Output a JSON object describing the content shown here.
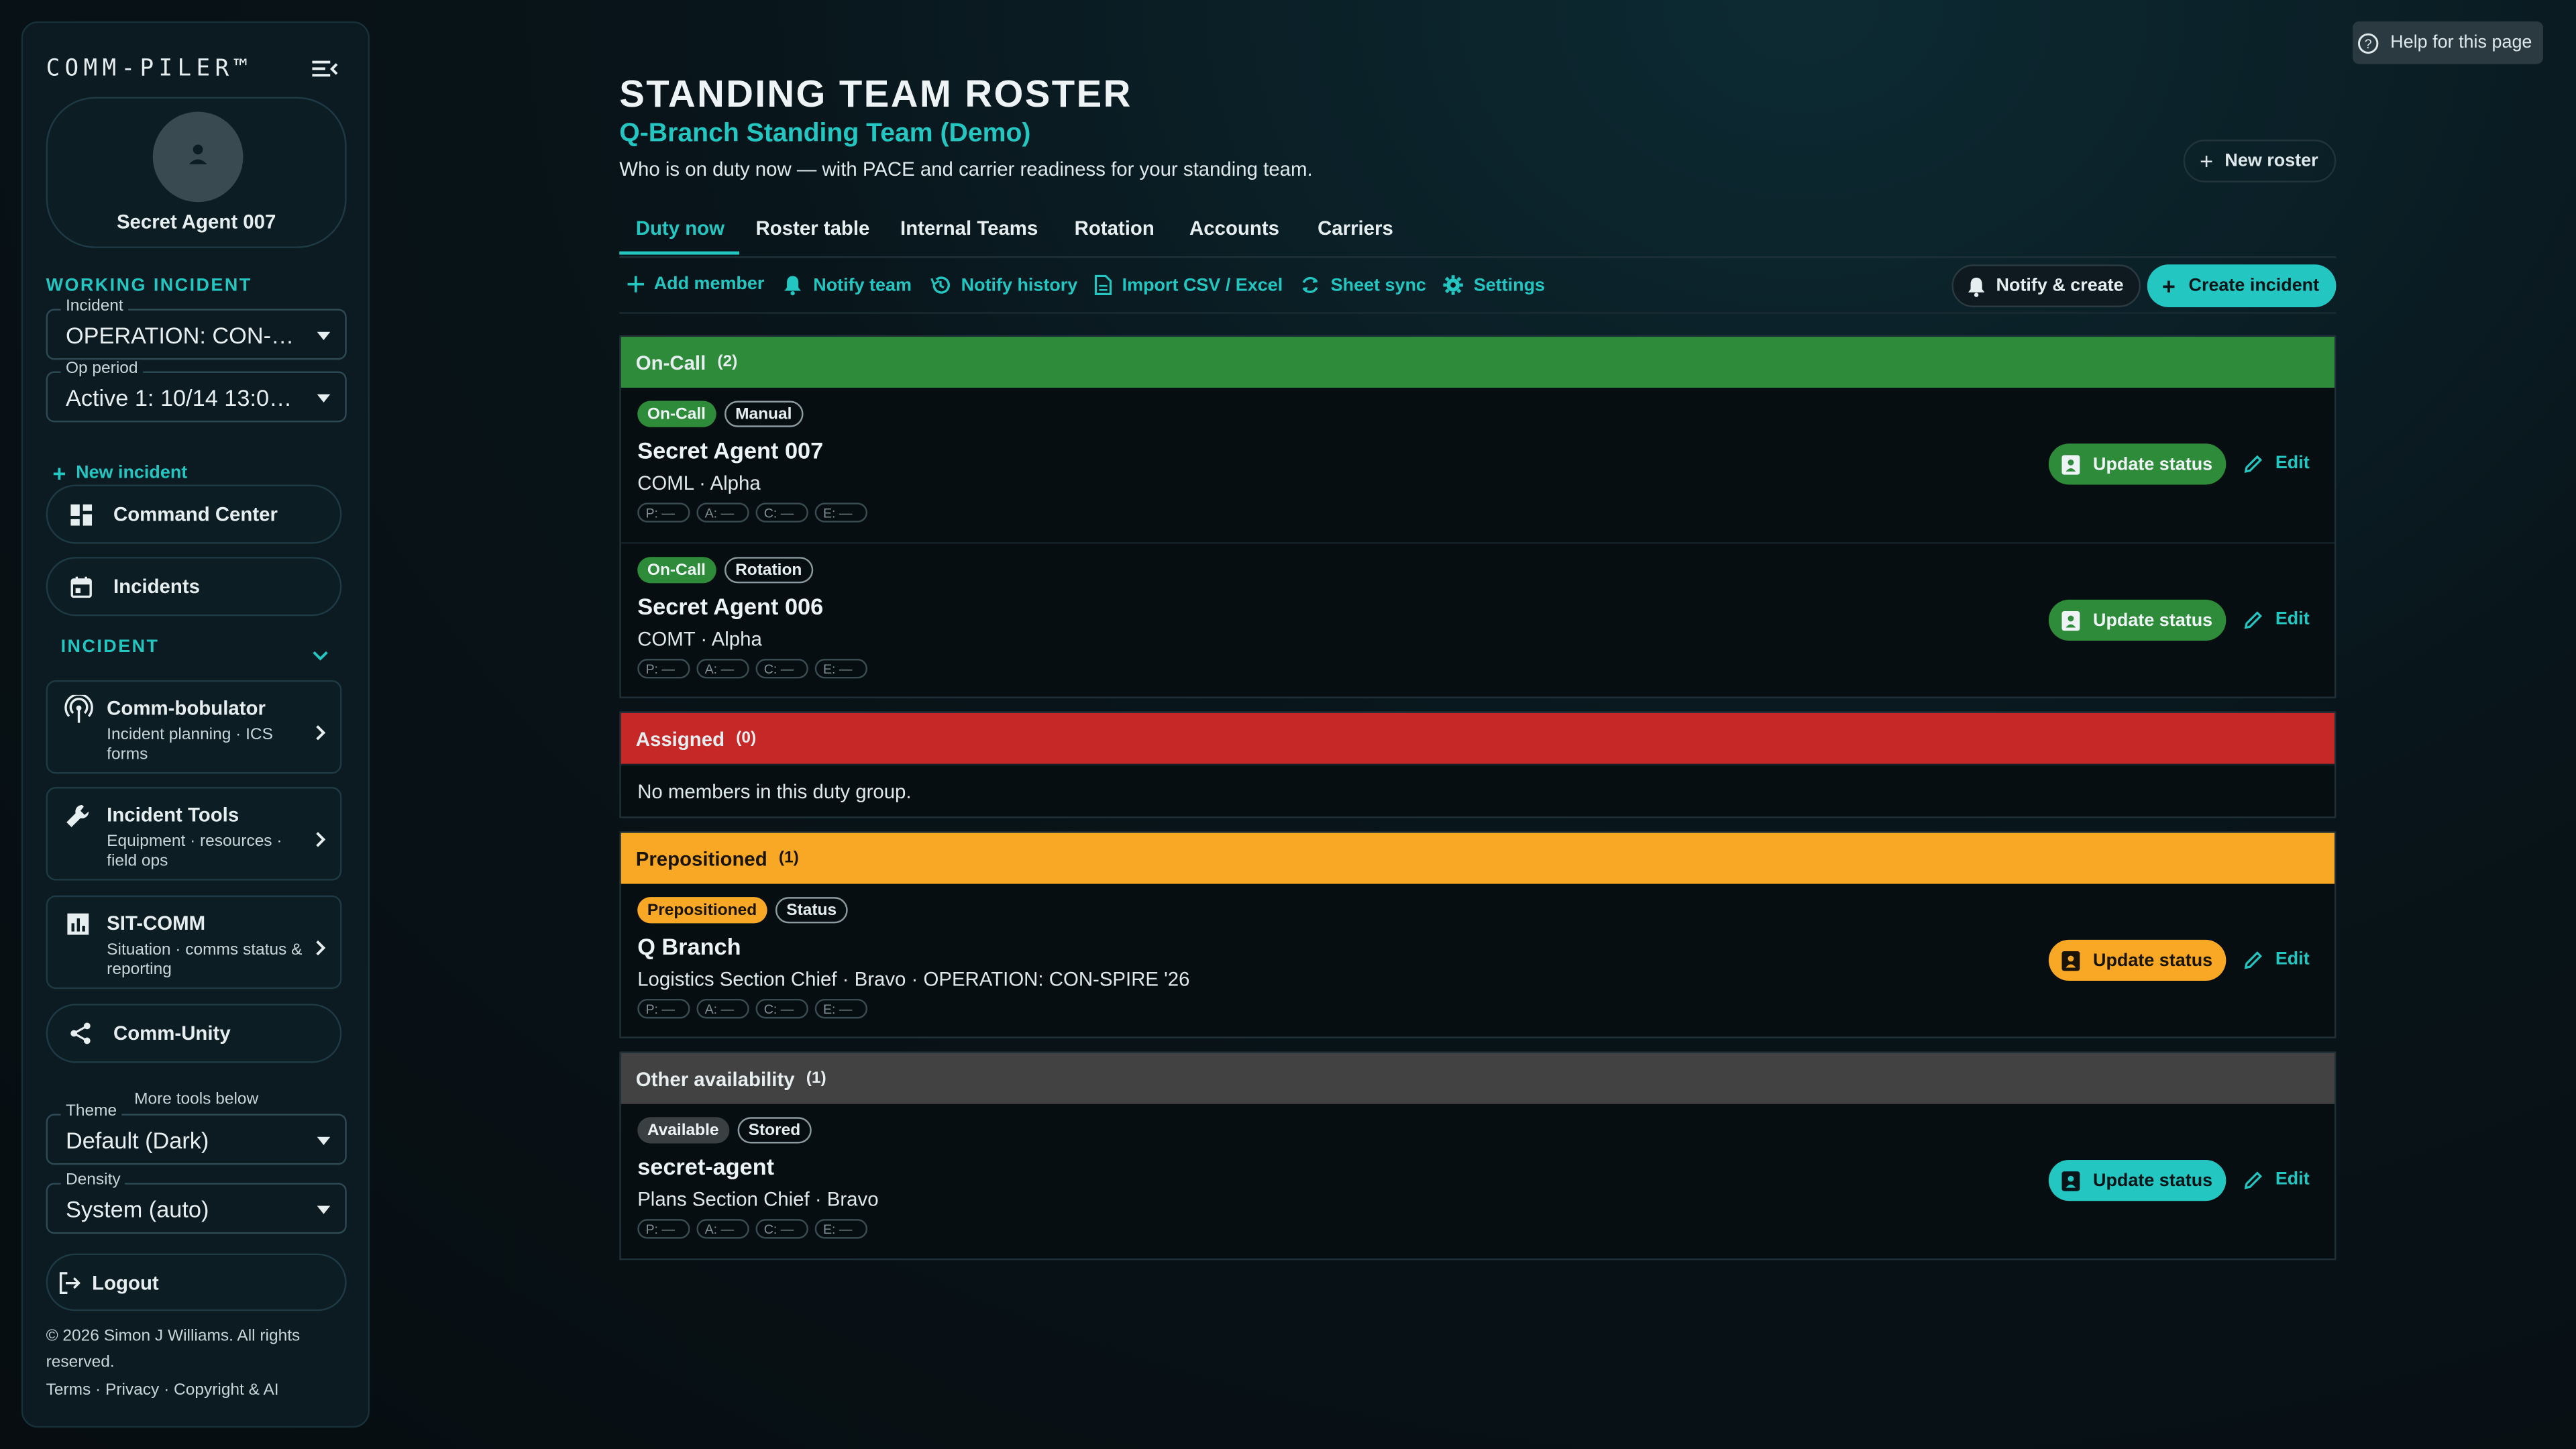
{
  "sidebar": {
    "brand": "COMM-PILER™",
    "user_name": "Secret Agent 007",
    "working_incident_label": "WORKING INCIDENT",
    "incident_field": {
      "label": "Incident",
      "value": "OPERATION: CON-SP..."
    },
    "op_period_field": {
      "label": "Op period",
      "value": "Active 1: 10/14 13:00–..."
    },
    "new_incident": "New incident",
    "command_center": "Command Center",
    "incidents": "Incidents",
    "incident_section": "INCIDENT",
    "tools": [
      {
        "title": "Comm-bobulator",
        "sub": "Incident planning · ICS forms"
      },
      {
        "title": "Incident Tools",
        "sub": "Equipment · resources · field ops"
      },
      {
        "title": "SIT-COMM",
        "sub": "Situation · comms status & reporting"
      }
    ],
    "comm_unity": "Comm-Unity",
    "more_tools": "More tools below",
    "theme_field": {
      "label": "Theme",
      "value": "Default (Dark)"
    },
    "density_field": {
      "label": "Density",
      "value": "System (auto)"
    },
    "logout": "Logout",
    "copyright": "© 2026 Simon J Williams. All rights reserved.",
    "legal": "Terms · Privacy · Copyright & AI"
  },
  "header": {
    "help": "Help for this page",
    "title": "STANDING TEAM ROSTER",
    "subtitle": "Q-Branch Standing Team (Demo)",
    "description": "Who is on duty now — with PACE and carrier readiness for your standing team.",
    "new_roster": "New roster"
  },
  "tabs": [
    "Duty now",
    "Roster table",
    "Internal Teams",
    "Rotation",
    "Accounts",
    "Carriers"
  ],
  "toolbar": {
    "add_member": "Add member",
    "notify_team": "Notify team",
    "notify_history": "Notify history",
    "import": "Import CSV / Excel",
    "sheet_sync": "Sheet sync",
    "settings": "Settings",
    "notify_create": "Notify & create",
    "create_incident": "Create incident"
  },
  "pace_labels": [
    "P: —",
    "A: —",
    "C: —",
    "E: —"
  ],
  "actions": {
    "update_status": "Update status",
    "edit": "Edit"
  },
  "groups": [
    {
      "name": "On-Call",
      "count": "(2)",
      "color": "#2e8b3a",
      "members": [
        {
          "badge": "On-Call",
          "source": "Manual",
          "name": "Secret Agent 007",
          "role": "COML · Alpha"
        },
        {
          "badge": "On-Call",
          "source": "Rotation",
          "name": "Secret Agent 006",
          "role": "COMT · Alpha"
        }
      ]
    },
    {
      "name": "Assigned",
      "count": "(0)",
      "color": "#c62828",
      "empty": "No members in this duty group."
    },
    {
      "name": "Prepositioned",
      "count": "(1)",
      "color": "#f9a825",
      "members": [
        {
          "badge": "Prepositioned",
          "source": "Status",
          "name": "Q Branch",
          "role": "Logistics Section Chief · Bravo · OPERATION: CON-SPIRE '26"
        }
      ]
    },
    {
      "name": "Other availability",
      "count": "(1)",
      "color": "#424242",
      "members": [
        {
          "badge": "Available",
          "source": "Stored",
          "name": "secret-agent",
          "role": "Plans Section Chief · Bravo"
        }
      ]
    }
  ],
  "colors": {
    "accent": "#23c6c0",
    "on_call": "#2e8b3a",
    "assigned": "#c62828",
    "prepositioned": "#f9a825",
    "other": "#424242"
  }
}
